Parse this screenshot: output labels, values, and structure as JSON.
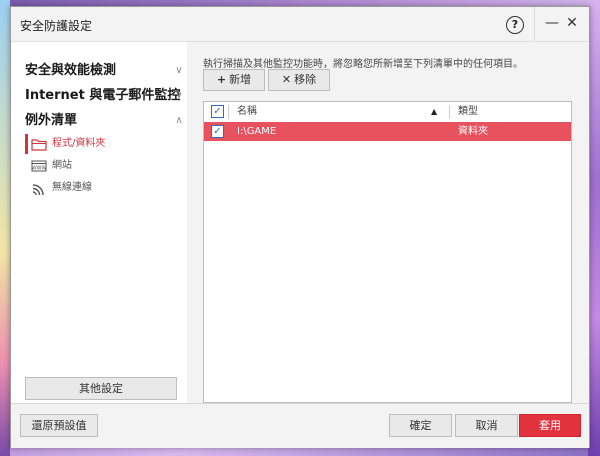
{
  "window": {
    "title": "安全防護設定"
  },
  "titlebar": {
    "help_glyph": "?",
    "minimize_glyph": "—",
    "close_glyph": "✕"
  },
  "sidebar": {
    "categories": [
      {
        "label": "安全與效能檢測",
        "chevron": "∨"
      },
      {
        "label": "Internet 與電子郵件監控",
        "chevron": "∨"
      },
      {
        "label": "例外清單",
        "chevron": "∧"
      }
    ],
    "subitems": [
      {
        "label": "程式/資料夾",
        "icon": "folder-icon",
        "active": true
      },
      {
        "label": "網站",
        "icon": "www-icon",
        "active": false
      },
      {
        "label": "無線連線",
        "icon": "wifi-icon",
        "active": false
      }
    ],
    "other_settings_label": "其他設定"
  },
  "main": {
    "description": "執行掃描及其他監控功能時，將忽略您所新增至下列清單中的任何項目。",
    "add_label": "新增",
    "add_glyph": "+",
    "remove_label": "移除",
    "remove_glyph": "✕",
    "table": {
      "headers": {
        "name": "名稱",
        "type": "類型"
      },
      "sort_glyph": "▲",
      "rows": [
        {
          "name": "I:\\GAME",
          "type": "資料夾",
          "checked": true,
          "selected": true
        }
      ]
    }
  },
  "footer": {
    "restore_label": "還原預設值",
    "ok_label": "確定",
    "cancel_label": "取消",
    "apply_label": "套用"
  },
  "colors": {
    "accent": "#e2323e",
    "selected_row": "#e8515e",
    "checkbox": "#2c6fb7"
  }
}
